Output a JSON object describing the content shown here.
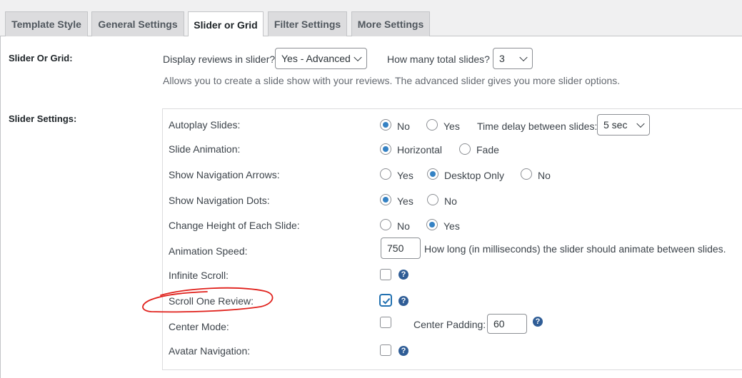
{
  "tabs": [
    {
      "label": "Template Style"
    },
    {
      "label": "General Settings"
    },
    {
      "label": "Slider or Grid",
      "active": true
    },
    {
      "label": "Filter Settings"
    },
    {
      "label": "More Settings"
    }
  ],
  "slider_or_grid": {
    "label": "Slider Or Grid:",
    "display_label": "Display reviews in slider?",
    "display_value": "Yes - Advanced",
    "total_label": "How many total slides?",
    "total_value": "3",
    "description": "Allows you to create a slide show with your reviews. The advanced slider gives you more slider options."
  },
  "slider_settings": {
    "label": "Slider Settings:",
    "autoplay": {
      "label": "Autoplay Slides:",
      "opt_no": "No",
      "opt_yes": "Yes",
      "selected": "No",
      "delay_label": "Time delay between slides:",
      "delay_value": "5 sec"
    },
    "animation": {
      "label": "Slide Animation:",
      "opt_horizontal": "Horizontal",
      "opt_fade": "Fade",
      "selected": "Horizontal"
    },
    "arrows": {
      "label": "Show Navigation Arrows:",
      "opt_yes": "Yes",
      "opt_desktop": "Desktop Only",
      "opt_no": "No",
      "selected": "Desktop Only"
    },
    "dots": {
      "label": "Show Navigation Dots:",
      "opt_yes": "Yes",
      "opt_no": "No",
      "selected": "Yes"
    },
    "height": {
      "label": "Change Height of Each Slide:",
      "opt_no": "No",
      "opt_yes": "Yes",
      "selected": "Yes"
    },
    "speed": {
      "label": "Animation Speed:",
      "value": "750",
      "description": "How long (in milliseconds) the slider should animate between slides."
    },
    "infinite": {
      "label": "Infinite Scroll:",
      "checked": false,
      "help": "?"
    },
    "scroll_one": {
      "label": "Scroll One Review:",
      "checked": true,
      "help": "?"
    },
    "center_mode": {
      "label": "Center Mode:",
      "checked": false,
      "padding_label": "Center Padding:",
      "padding_value": "60",
      "help": "?"
    },
    "avatar_nav": {
      "label": "Avatar Navigation:",
      "checked": false,
      "help": "?"
    }
  },
  "colors": {
    "accent": "#3582c4",
    "annotation": "#e0201b",
    "help_icon": "#2f5d96"
  }
}
